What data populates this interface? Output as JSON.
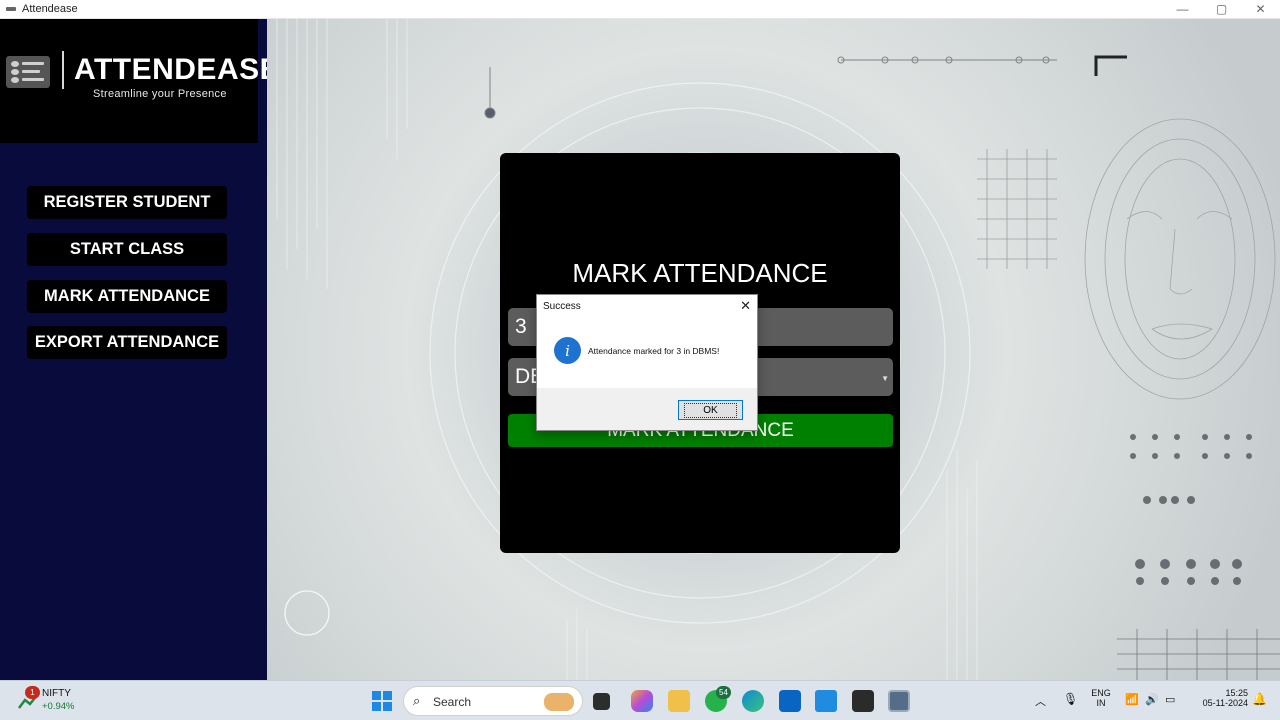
{
  "window": {
    "title": "Attendease",
    "minimize": "—",
    "maximize": "▢",
    "close": "✕"
  },
  "sidebar": {
    "logo_title": "ATTENDEASE",
    "logo_subtitle": "Streamline your Presence",
    "items": [
      {
        "label": "REGISTER STUDENT"
      },
      {
        "label": "START CLASS"
      },
      {
        "label": "MARK ATTENDANCE"
      },
      {
        "label": "EXPORT ATTENDANCE"
      }
    ]
  },
  "panel": {
    "title": "MARK ATTENDANCE",
    "student_value": "3",
    "subject_value": "DE",
    "button_label": "MARK ATTENDANCE"
  },
  "dialog": {
    "title": "Success",
    "close": "✕",
    "icon": "info-icon",
    "message": "Attendance marked for 3 in DBMS!",
    "ok_label": "OK"
  },
  "taskbar": {
    "stock_name": "NIFTY",
    "stock_change": "+0.94%",
    "stock_badge": "1",
    "search_placeholder": "Search",
    "whatsapp_badge": "54",
    "language": "ENG",
    "region": "IN",
    "time": "15:25",
    "date": "05-11-2024",
    "apps": [
      "windows-start-icon",
      "task-view-icon",
      "copilot-icon",
      "file-explorer-icon",
      "whatsapp-icon",
      "edge-icon",
      "outlook-icon",
      "vscode-icon",
      "terminal-icon",
      "python-app-icon"
    ]
  },
  "colors": {
    "sidebar": "#0a0b3d",
    "panel": "#000000",
    "accent_button": "#008000",
    "info": "#1f73d0"
  }
}
